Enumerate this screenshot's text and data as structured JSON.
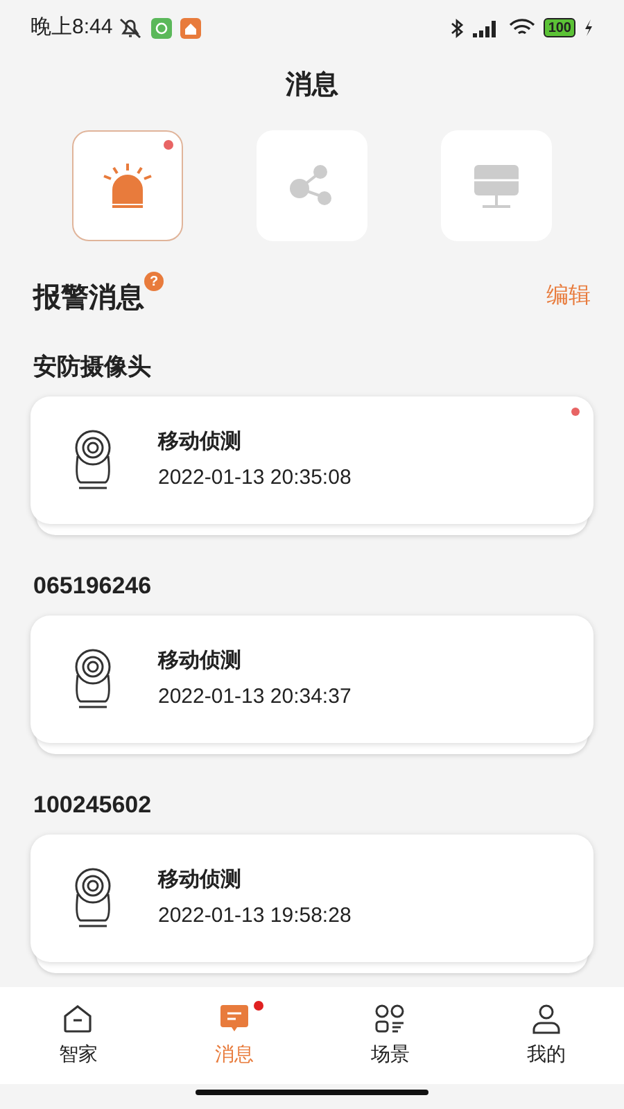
{
  "status_bar": {
    "time": "晚上8:44",
    "battery": "100"
  },
  "title": "消息",
  "categories": [
    {
      "kind": "alarm",
      "selected": true,
      "unread": true
    },
    {
      "kind": "share",
      "selected": false,
      "unread": false
    },
    {
      "kind": "device",
      "selected": false,
      "unread": false
    }
  ],
  "section": {
    "title": "报警消息",
    "help": "?",
    "action": "编辑"
  },
  "groups": [
    {
      "name": "安防摄像头",
      "messages": [
        {
          "event": "移动侦测",
          "time": "2022-01-13 20:35:08",
          "unread": true
        }
      ]
    },
    {
      "name": "065196246",
      "messages": [
        {
          "event": "移动侦测",
          "time": "2022-01-13 20:34:37",
          "unread": false
        }
      ]
    },
    {
      "name": "100245602",
      "messages": [
        {
          "event": "移动侦测",
          "time": "2022-01-13 19:58:28",
          "unread": false
        }
      ]
    }
  ],
  "nav": [
    {
      "kind": "home",
      "label": "智家",
      "selected": false,
      "badge": false
    },
    {
      "kind": "message",
      "label": "消息",
      "selected": true,
      "badge": true
    },
    {
      "kind": "scene",
      "label": "场景",
      "selected": false,
      "badge": false
    },
    {
      "kind": "profile",
      "label": "我的",
      "selected": false,
      "badge": false
    }
  ]
}
